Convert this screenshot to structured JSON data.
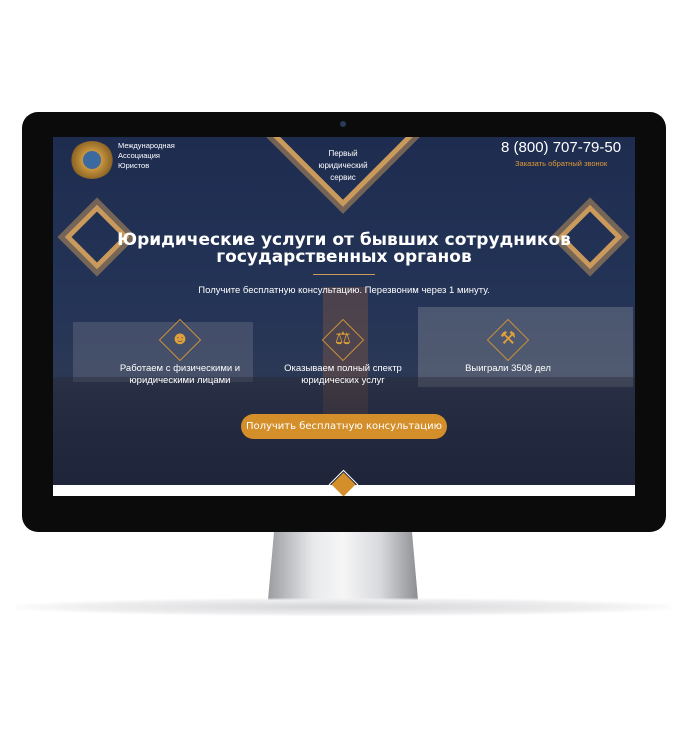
{
  "header": {
    "org_name_lines": [
      "Международная",
      "Ассоциация",
      "Юристов"
    ],
    "phone": "8 (800) 707-79-50",
    "callback_link": "Заказать обратный звонок"
  },
  "badge": {
    "lines": [
      "Первый",
      "юридический",
      "сервис"
    ]
  },
  "hero": {
    "title_lines": [
      "Юридические услуги от бывших сотрудников",
      "государственных органов"
    ],
    "subtitle": "Получите бесплатную консультацию. Перезвоним через 1 минуту."
  },
  "features": [
    {
      "icon": "lawyer-person-icon",
      "lines": [
        "Работаем с физическими и",
        "юридическими лицами"
      ]
    },
    {
      "icon": "scales-icon",
      "lines": [
        "Оказываем полный спектр",
        "юридических услуг"
      ]
    },
    {
      "icon": "gavel-icon",
      "lines": [
        "Выиграли 3508 дел"
      ]
    }
  ],
  "cta_label": "Получить бесплатную консультацию",
  "colors": {
    "accent": "#d48f2b",
    "gold": "#c99a5b",
    "background": "#1f2d4e"
  }
}
